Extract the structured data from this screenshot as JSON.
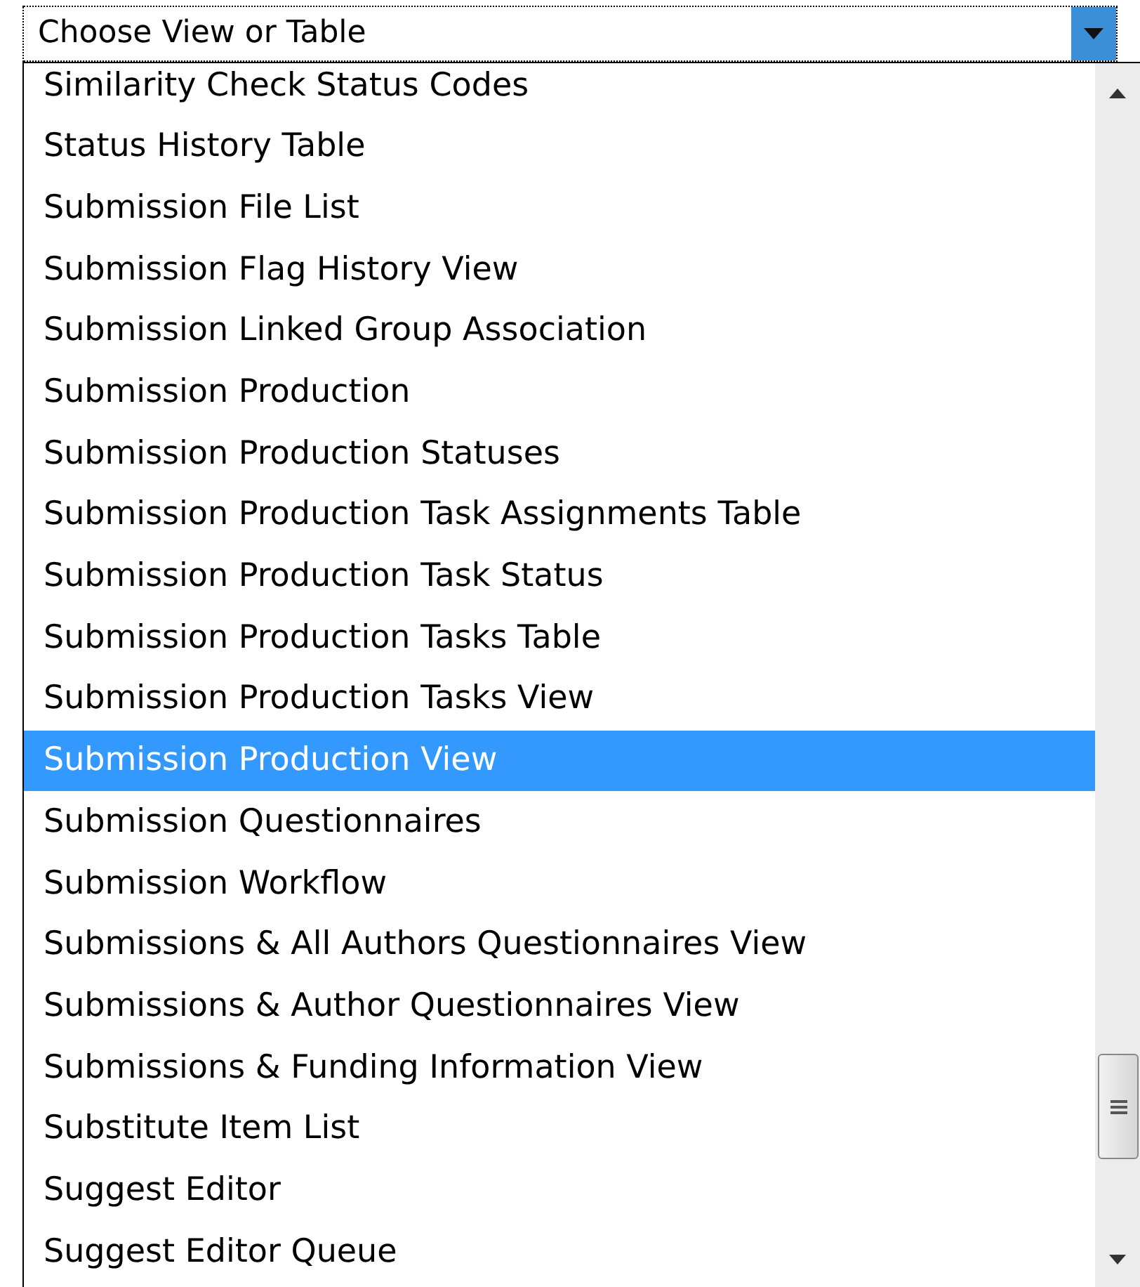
{
  "combo_box": {
    "value": "Choose View or Table"
  },
  "list": {
    "items": [
      {
        "label": "Similarity Check Status Codes",
        "selected": false
      },
      {
        "label": "Status History Table",
        "selected": false
      },
      {
        "label": "Submission File List",
        "selected": false
      },
      {
        "label": "Submission Flag History View",
        "selected": false
      },
      {
        "label": "Submission Linked Group Association",
        "selected": false
      },
      {
        "label": "Submission Production",
        "selected": false
      },
      {
        "label": "Submission Production Statuses",
        "selected": false
      },
      {
        "label": "Submission Production Task Assignments Table",
        "selected": false
      },
      {
        "label": "Submission Production Task Status",
        "selected": false
      },
      {
        "label": "Submission Production Tasks Table",
        "selected": false
      },
      {
        "label": "Submission Production Tasks View",
        "selected": false
      },
      {
        "label": "Submission Production View",
        "selected": true
      },
      {
        "label": "Submission Questionnaires",
        "selected": false
      },
      {
        "label": "Submission Workflow",
        "selected": false
      },
      {
        "label": "Submissions & All Authors Questionnaires View",
        "selected": false
      },
      {
        "label": "Submissions & Author Questionnaires View",
        "selected": false
      },
      {
        "label": "Submissions & Funding Information View",
        "selected": false
      },
      {
        "label": "Substitute Item List",
        "selected": false
      },
      {
        "label": "Suggest Editor",
        "selected": false
      },
      {
        "label": "Suggest Editor Queue",
        "selected": false
      }
    ]
  }
}
